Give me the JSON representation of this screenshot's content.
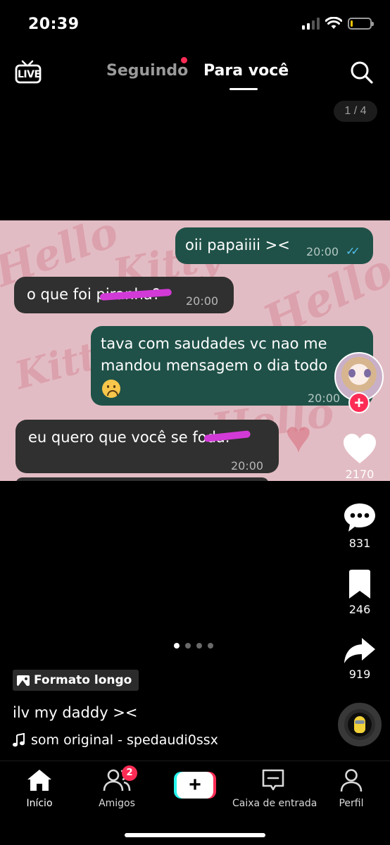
{
  "status_bar": {
    "time": "20:39",
    "battery_level": 0.12,
    "signal_bars": 2
  },
  "top_nav": {
    "live_label": "LIVE",
    "tabs": [
      {
        "label": "Seguindo",
        "active": false,
        "has_dot": true
      },
      {
        "label": "Para você",
        "active": true
      }
    ],
    "page_indicator": "1 / 4"
  },
  "chat": {
    "messages": [
      {
        "direction": "out",
        "text": "oii papaiiii ><",
        "time": "20:00",
        "read": true
      },
      {
        "direction": "in",
        "text": "o que foi piranha?",
        "time": "20:00",
        "scribbled": "piranha"
      },
      {
        "direction": "out",
        "line1": "tava com saudades vc nao me",
        "line2": "mandou mensagem o dia todo",
        "time": "20:00"
      },
      {
        "direction": "in",
        "text": "eu quero que você se foda.",
        "time": "20:00",
        "scribbled": "foda"
      }
    ],
    "background_text": "Hello Kitty"
  },
  "right_rail": {
    "likes": "2170",
    "comments": "831",
    "saves": "246",
    "shares": "919"
  },
  "carousel": {
    "count": 4,
    "active_index": 0
  },
  "caption": {
    "format_badge": "Formato longo",
    "text": "ilv my daddy ><",
    "sound": "som original - spedaudi0ssx"
  },
  "bottom_nav": {
    "home": "Início",
    "friends": "Amigos",
    "friends_badge": "2",
    "inbox": "Caixa de entrada",
    "profile": "Perfil"
  },
  "colors": {
    "accent_red": "#fe2c55",
    "accent_cyan": "#25f4ee",
    "bubble_out": "#1f5148",
    "bubble_in": "#303030",
    "chat_bg": "#e2bcc4",
    "scribble": "#d23ad7"
  }
}
